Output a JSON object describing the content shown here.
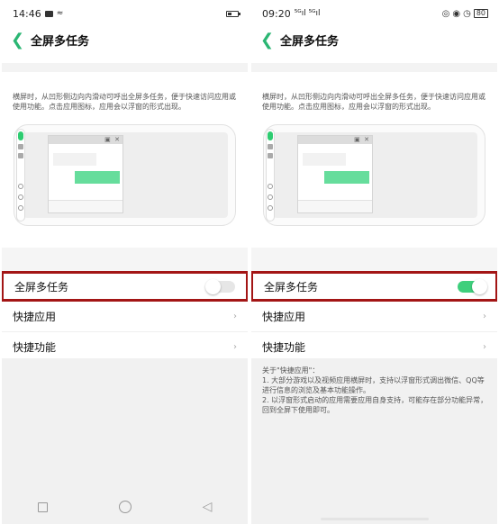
{
  "left": {
    "status": {
      "time": "14:46"
    },
    "header": {
      "title": "全屏多任务"
    },
    "description": "横屏时，从凹形侧边向内滑动可呼出全屏多任务，便于快速访问应用或使用功能。点击应用图标，应用会以浮窗的形式出现。",
    "toggle_row": {
      "label": "全屏多任务",
      "state": "off"
    },
    "rows": [
      {
        "label": "快捷应用",
        "chevron": "›"
      },
      {
        "label": "快捷功能",
        "chevron": "›"
      }
    ],
    "navbar": {
      "icons": [
        "square-icon",
        "circle-icon",
        "back-triangle-icon"
      ]
    }
  },
  "right": {
    "status": {
      "time": "09:20",
      "signal": "⁵ᴳıl ⁵ᴳıl",
      "battery_text": "80"
    },
    "header": {
      "title": "全屏多任务"
    },
    "description": "横屏时，从凹形侧边向内滑动可呼出全屏多任务，便于快速访问应用或使用功能。点击应用图标，应用会以浮窗的形式出现。",
    "toggle_row": {
      "label": "全屏多任务",
      "state": "on"
    },
    "rows": [
      {
        "label": "快捷应用",
        "chevron": "›"
      },
      {
        "label": "快捷功能",
        "chevron": "›"
      }
    ],
    "note": {
      "title": "关于\"快捷应用\"：",
      "line1": "1. 大部分游戏以及视频应用横屏时，支持以浮窗形式调出微信、QQ等进行信息的浏览及基本功能操作。",
      "line2": "2. 以浮窗形式启动的应用需要应用自身支持，可能存在部分功能异常，回到全屏下使用即可。"
    }
  },
  "colors": {
    "accent_green": "#2bb673",
    "toggle_on": "#3ecf7c",
    "highlight_red": "#a31515",
    "illustration_message": "#66dd9c"
  }
}
